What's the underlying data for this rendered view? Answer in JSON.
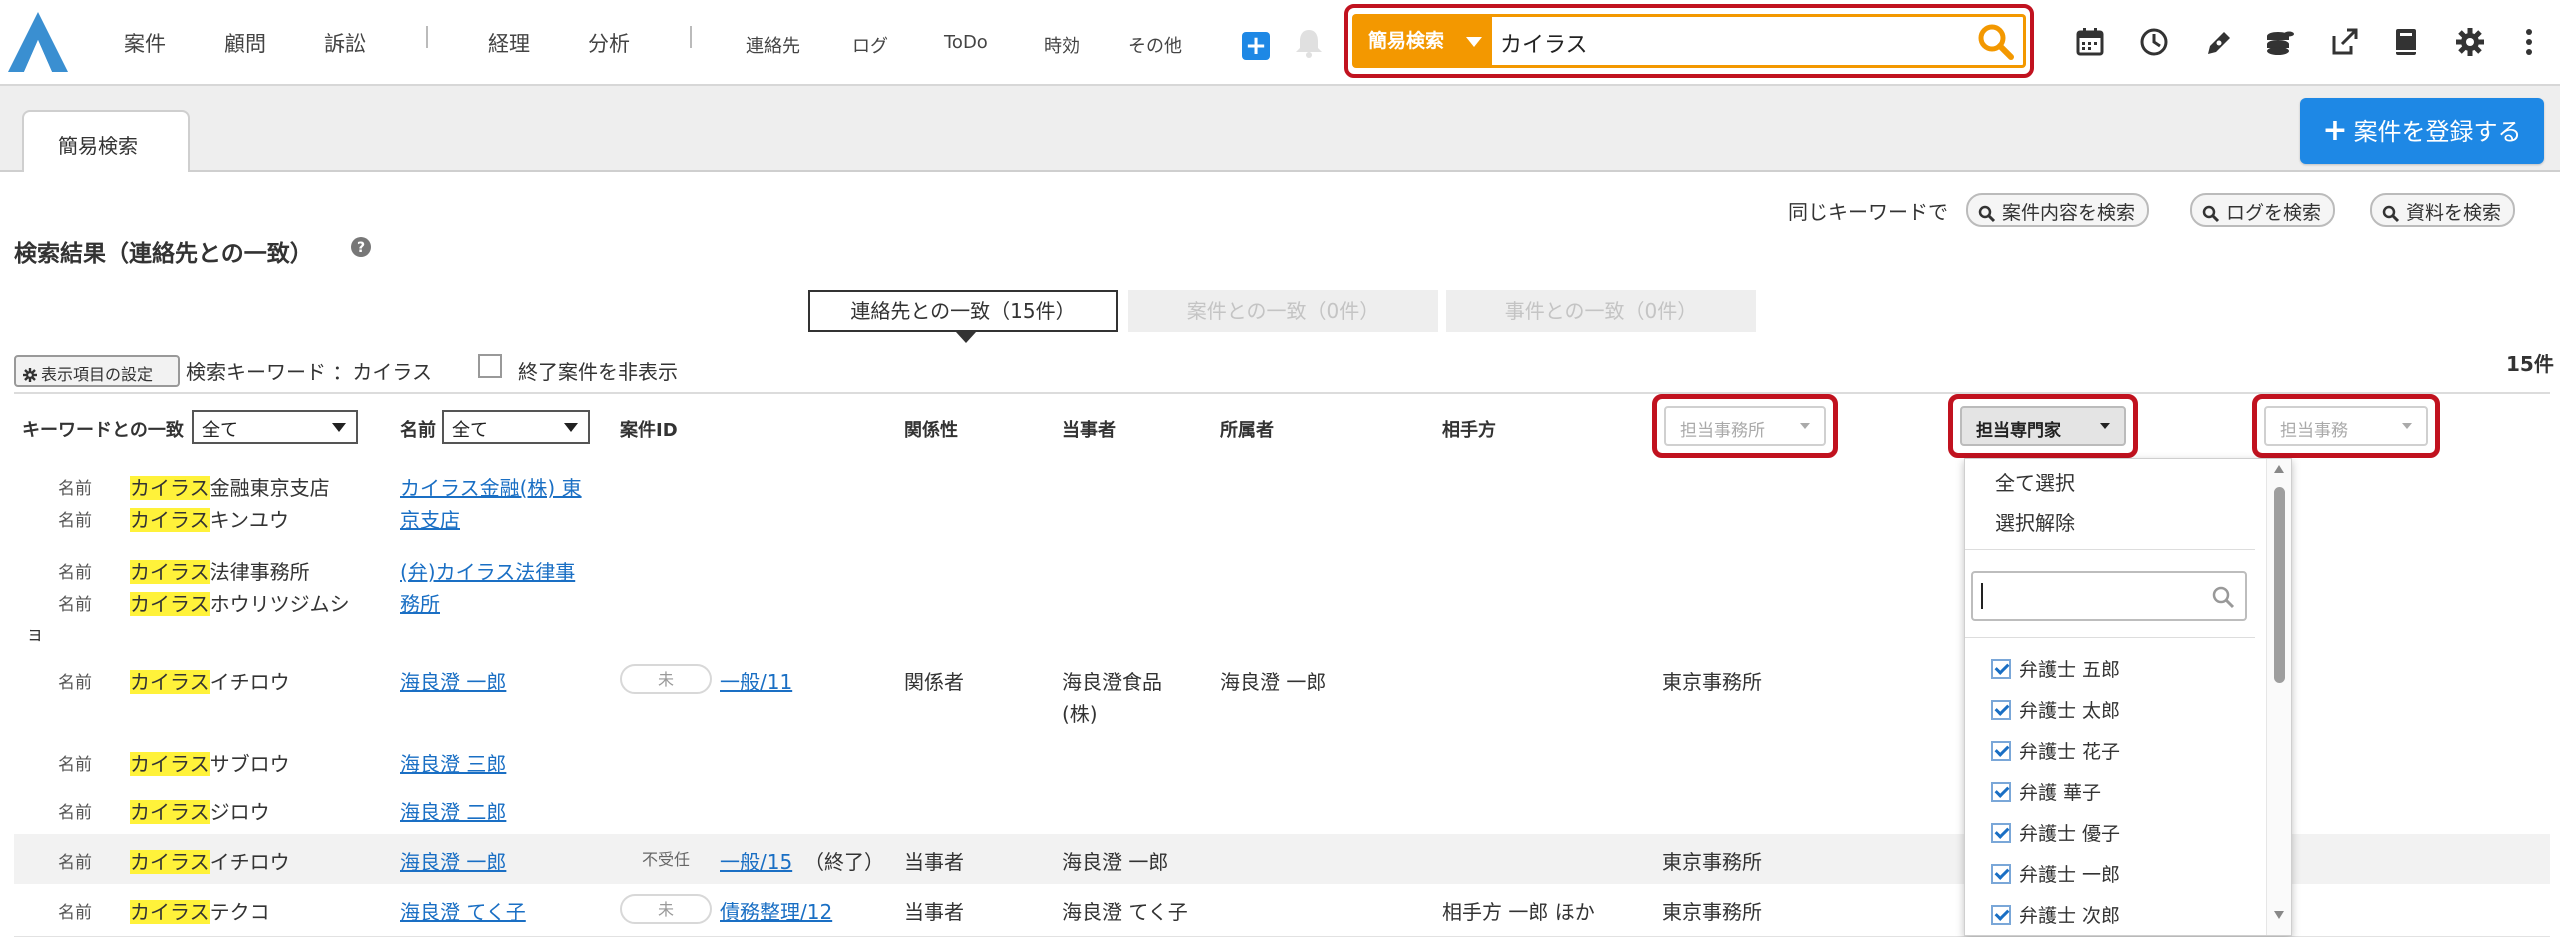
{
  "nav": {
    "main": [
      "案件",
      "顧問",
      "訴訟",
      "経理",
      "分析"
    ],
    "sub": [
      "連絡先",
      "ログ",
      "ToDo",
      "時効",
      "その他"
    ]
  },
  "search": {
    "scope_label": "簡易検索",
    "query": "カイラス"
  },
  "tabs": {
    "active": "簡易検索"
  },
  "register_button": "案件を登録する",
  "same_keyword": {
    "label": "同じキーワードで",
    "buttons": [
      "案件内容を検索",
      "ログを検索",
      "資料を検索"
    ]
  },
  "results": {
    "title": "検索結果（連絡先との一致）",
    "segments": [
      "連絡先との一致（15件）",
      "案件との一致（0件）",
      "事件との一致（0件）"
    ],
    "settings_button": "表示項目の設定",
    "keyword_label": "検索キーワード ：カイラス",
    "hide_closed_label": "終了案件を非表示",
    "total_count": "15件"
  },
  "table": {
    "headers": {
      "keyword_match": "キーワードとの一致",
      "keyword_match_filter": "全て",
      "name": "名前",
      "name_filter": "全て",
      "case_id": "案件ID",
      "relation": "関係性",
      "party": "当事者",
      "affiliation": "所属者",
      "opponent": "相手方",
      "office_filter": "担当事務所",
      "expert_filter": "担当専門家",
      "staff_filter": "担当事務"
    },
    "rows": [
      {
        "matches": [
          {
            "label": "名前",
            "hit": "カイラス",
            "rest": "金融東京支店"
          },
          {
            "label": "名前",
            "hit": "カイラス",
            "rest": "キンユウ"
          }
        ],
        "name_line1": "カイラス金融(株) 東",
        "name_line2": "京支店"
      },
      {
        "matches": [
          {
            "label": "名前",
            "hit": "カイラス",
            "rest": "法律事務所"
          },
          {
            "label": "名前",
            "hit": "カイラス",
            "rest": "ホウリツジムシ"
          }
        ],
        "overflow": "ョ",
        "name_line1": "(弁)カイラス法律事",
        "name_line2": "務所"
      },
      {
        "match": {
          "label": "名前",
          "hit": "カイラス",
          "rest": "イチロウ"
        },
        "name": "海良澄 一郎",
        "status": "未",
        "case_link": "一般/11",
        "relation": "関係者",
        "party_line1": "海良澄食品",
        "party_line2": "(株)",
        "affiliation": "海良澄 一郎",
        "office": "東京事務所"
      },
      {
        "match": {
          "label": "名前",
          "hit": "カイラス",
          "rest": "サブロウ"
        },
        "name": "海良澄 三郎"
      },
      {
        "match": {
          "label": "名前",
          "hit": "カイラス",
          "rest": "ジロウ"
        },
        "name": "海良澄 二郎"
      },
      {
        "match": {
          "label": "名前",
          "hit": "カイラス",
          "rest": "イチロウ"
        },
        "name": "海良澄 一郎",
        "status": "不受任",
        "case_link": "一般/15",
        "case_suffix": "（終了）",
        "relation": "当事者",
        "party": "海良澄 一郎",
        "office": "東京事務所"
      },
      {
        "match": {
          "label": "名前",
          "hit": "カイラス",
          "rest": "テクコ"
        },
        "name": "海良澄 てく子",
        "status": "未",
        "case_link": "債務整理/12",
        "relation": "当事者",
        "party": "海良澄 てく子",
        "opponent": "相手方 一郎 ほか",
        "office": "東京事務所"
      }
    ]
  },
  "dropdown": {
    "select_all": "全て選択",
    "deselect": "選択解除",
    "items": [
      "弁護士 五郎",
      "弁護士 太郎",
      "弁護士 花子",
      "弁護 華子",
      "弁護士 優子",
      "弁護士 一郎",
      "弁護士 次郎"
    ]
  },
  "colors": {
    "accent_blue": "#1e88e5",
    "search_orange": "#f39800",
    "highlight_red": "#c1121f",
    "keyword_highlight": "#fff23a",
    "link_blue": "#1a6fc4"
  }
}
